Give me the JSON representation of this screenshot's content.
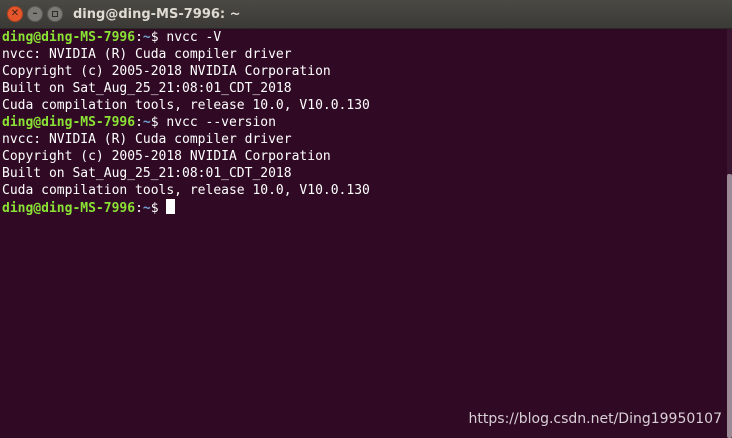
{
  "window": {
    "title": "ding@ding-MS-7996: ~",
    "close_glyph": "✕",
    "minimize_glyph": "–"
  },
  "terminal": {
    "lines": [
      {
        "type": "prompt",
        "user": "ding@ding-MS-7996",
        "path": "~",
        "command": "nvcc -V"
      },
      {
        "type": "output",
        "text": "nvcc: NVIDIA (R) Cuda compiler driver"
      },
      {
        "type": "output",
        "text": "Copyright (c) 2005-2018 NVIDIA Corporation"
      },
      {
        "type": "output",
        "text": "Built on Sat_Aug_25_21:08:01_CDT_2018"
      },
      {
        "type": "output",
        "text": "Cuda compilation tools, release 10.0, V10.0.130"
      },
      {
        "type": "prompt",
        "user": "ding@ding-MS-7996",
        "path": "~",
        "command": "nvcc --version"
      },
      {
        "type": "output",
        "text": "nvcc: NVIDIA (R) Cuda compiler driver"
      },
      {
        "type": "output",
        "text": "Copyright (c) 2005-2018 NVIDIA Corporation"
      },
      {
        "type": "output",
        "text": "Built on Sat_Aug_25_21:08:01_CDT_2018"
      },
      {
        "type": "output",
        "text": "Cuda compilation tools, release 10.0, V10.0.130"
      },
      {
        "type": "prompt",
        "user": "ding@ding-MS-7996",
        "path": "~",
        "command": "",
        "cursor": true
      }
    ]
  },
  "colors": {
    "background": "#300a24",
    "prompt_user": "#8ae234",
    "prompt_path": "#729fcf",
    "text": "#ffffff"
  },
  "watermark": "https://blog.csdn.net/Ding19950107"
}
